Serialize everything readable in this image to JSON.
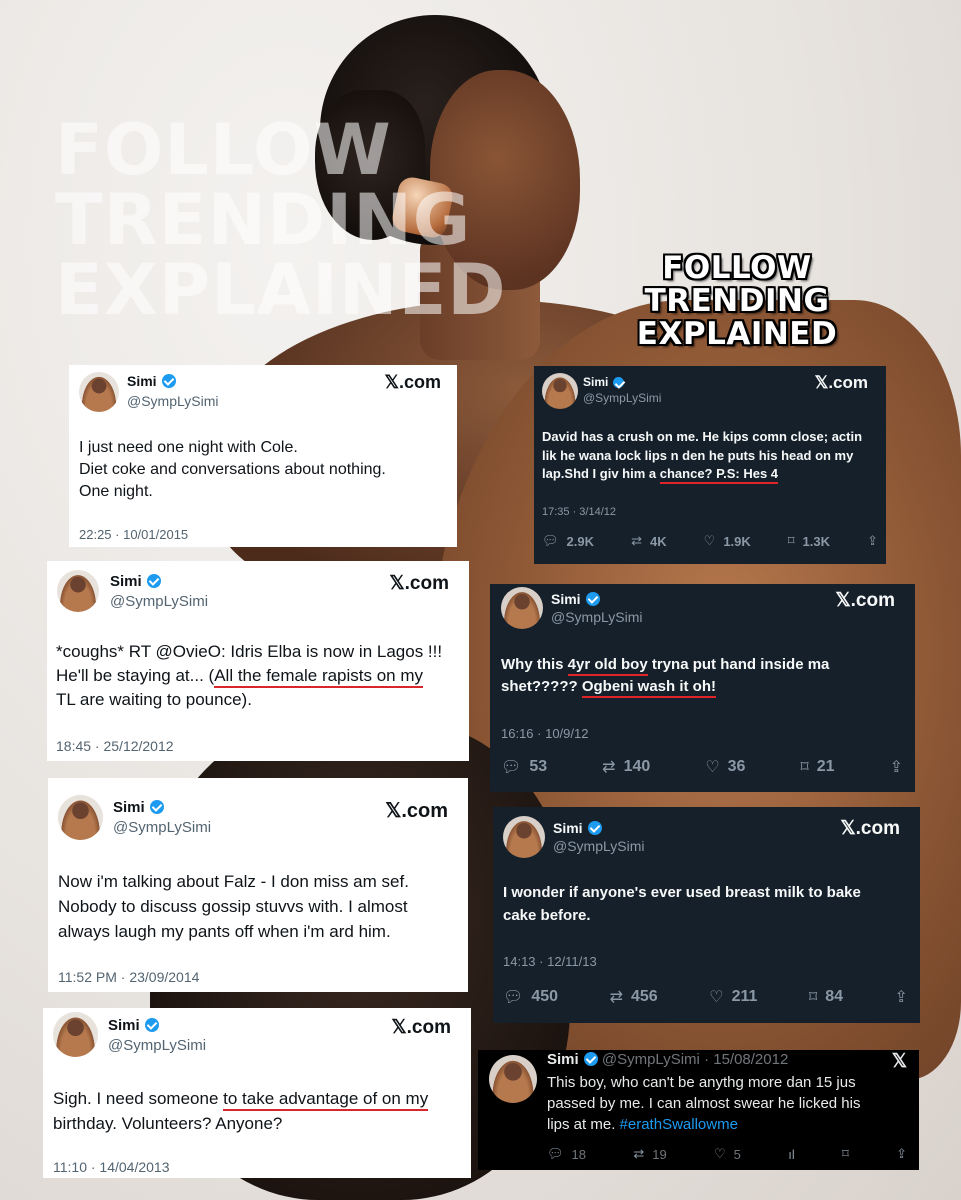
{
  "watermark": {
    "line1": "FOLLOW",
    "line2": "TRENDING",
    "line3": "EXPLAINED"
  },
  "brand": {
    "line1": "FOLLOW",
    "line2": "TRENDING",
    "line3": "EXPLAINED"
  },
  "tweets": [
    {
      "theme": "light",
      "name": "Simi",
      "handle": "@SympLySimi",
      "source": "𝕏.com",
      "text": "I just need one night with Cole.\nDiet coke and conversations about nothing.\nOne night.",
      "timestamp": "22:25 · 10/01/2015"
    },
    {
      "theme": "light",
      "name": "Simi",
      "handle": "@SympLySimi",
      "source": "𝕏.com",
      "text_pre": "*coughs* RT @OvieO: Idris Elba is now in Lagos !!!\nHe'll be staying at... (",
      "text_ul": "All the female rapists on my",
      "text_post": "\nTL are waiting to pounce).",
      "timestamp": "18:45 · 25/12/2012"
    },
    {
      "theme": "light",
      "name": "Simi",
      "handle": "@SympLySimi",
      "source": "𝕏.com",
      "text": "Now i'm talking about Falz - I don miss am sef.\nNobody to discuss gossip stuvvs with. I almost\nalways laugh my pants off when i'm ard him.",
      "timestamp": "11:52 PM · 23/09/2014"
    },
    {
      "theme": "light",
      "name": "Simi",
      "handle": "@SympLySimi",
      "source": "𝕏.com",
      "text_pre": "Sigh. I need someone ",
      "text_ul": "to take advantage of on my",
      "text_post": "\nbirthday. Volunteers? Anyone?",
      "timestamp": "11:10 · 14/04/2013"
    },
    {
      "theme": "dark",
      "name": "Simi",
      "handle": "@SympLySimi",
      "source": "𝕏.com",
      "text_pre": "David has a crush on me. He kips comn close; actin\nlik he wana lock lips n den he puts his head on my\nlap.Shd I giv him a ",
      "text_ul": "chance? P.S: Hes 4",
      "text_post": "",
      "timestamp": "17:35 · 3/14/12",
      "replies": "2.9K",
      "reposts": "4K",
      "likes": "1.9K",
      "bookmarks": "1.3K"
    },
    {
      "theme": "dark",
      "name": "Simi",
      "handle": "@SympLySimi",
      "source": "𝕏.com",
      "text_pre": "Why this ",
      "text_ul": "4yr old boy",
      "text_mid": " tryna put hand inside ma\nshet????? ",
      "text_ul2": "Ogbeni wash it oh!",
      "text_post": "",
      "timestamp": "16:16 · 10/9/12",
      "replies": "53",
      "reposts": "140",
      "likes": "36",
      "bookmarks": "21"
    },
    {
      "theme": "dark",
      "name": "Simi",
      "handle": "@SympLySimi",
      "source": "𝕏.com",
      "text": "I wonder if anyone's ever used breast milk to bake\ncake before.",
      "timestamp": "14:13 · 12/11/13",
      "replies": "450",
      "reposts": "456",
      "likes": "211",
      "bookmarks": "84"
    },
    {
      "theme": "black",
      "name": "Simi",
      "handle": "@SympLySimi",
      "date": "· 15/08/2012",
      "source": "𝕏",
      "text": "This boy, who can't be anythg more dan 15 jus\npassed by me. I can almost swear he licked his\nlips at me. ",
      "hashtag": "#erathSwallowme",
      "replies": "18",
      "reposts": "19",
      "likes": "5"
    }
  ],
  "colors": {
    "underline": "#d9262b",
    "verified": "#1d9bf0",
    "dark_card": "#15202b"
  }
}
